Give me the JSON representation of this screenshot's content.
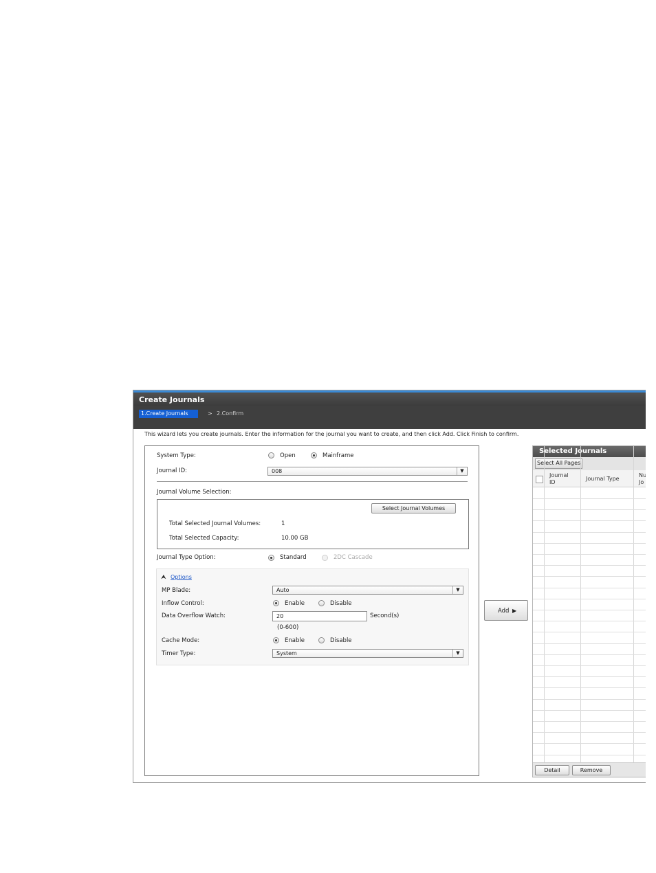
{
  "window": {
    "title": "Create Journals",
    "steps": [
      {
        "label": "1.Create Journals",
        "active": true
      },
      {
        "label": "2.Confirm",
        "active": false
      }
    ],
    "step_separator": ">",
    "intro": "This wizard lets you create journals. Enter the information for the journal you want to create, and then click Add. Click Finish to confirm.",
    "accent_color": "#3a8ad6",
    "active_step_color": "#1560d4"
  },
  "form": {
    "system_type": {
      "label": "System Type:",
      "options": [
        "Open",
        "Mainframe"
      ],
      "selected": "Mainframe"
    },
    "journal_id": {
      "label": "Journal ID:",
      "value": "008"
    },
    "journal_volume_selection": {
      "label": "Journal Volume Selection:",
      "button": "Select Journal Volumes",
      "total_volumes_label": "Total Selected Journal Volumes:",
      "total_volumes_value": "1",
      "total_capacity_label": "Total Selected Capacity:",
      "total_capacity_value": "10.00 GB"
    },
    "journal_type_option": {
      "label": "Journal Type Option:",
      "options": [
        "Standard",
        "2DC Cascade"
      ],
      "selected": "Standard"
    },
    "options": {
      "link": "Options",
      "mp_blade": {
        "label": "MP Blade:",
        "value": "Auto"
      },
      "inflow_control": {
        "label": "Inflow Control:",
        "options": [
          "Enable",
          "Disable"
        ],
        "selected": "Enable"
      },
      "data_overflow_watch": {
        "label": "Data Overflow Watch:",
        "value": "20",
        "unit": "Second(s)",
        "range": "(0-600)"
      },
      "cache_mode": {
        "label": "Cache Mode:",
        "options": [
          "Enable",
          "Disable"
        ],
        "selected": "Enable"
      },
      "timer_type": {
        "label": "Timer Type:",
        "value": "System"
      }
    }
  },
  "add_button": "Add",
  "selected_journals": {
    "title": "Selected Journals",
    "select_all": "Select All Pages",
    "columns": [
      "Journal ID",
      "Journal Type",
      "Nu Jo"
    ],
    "rows": [],
    "detail_button": "Detail",
    "remove_button": "Remove"
  }
}
